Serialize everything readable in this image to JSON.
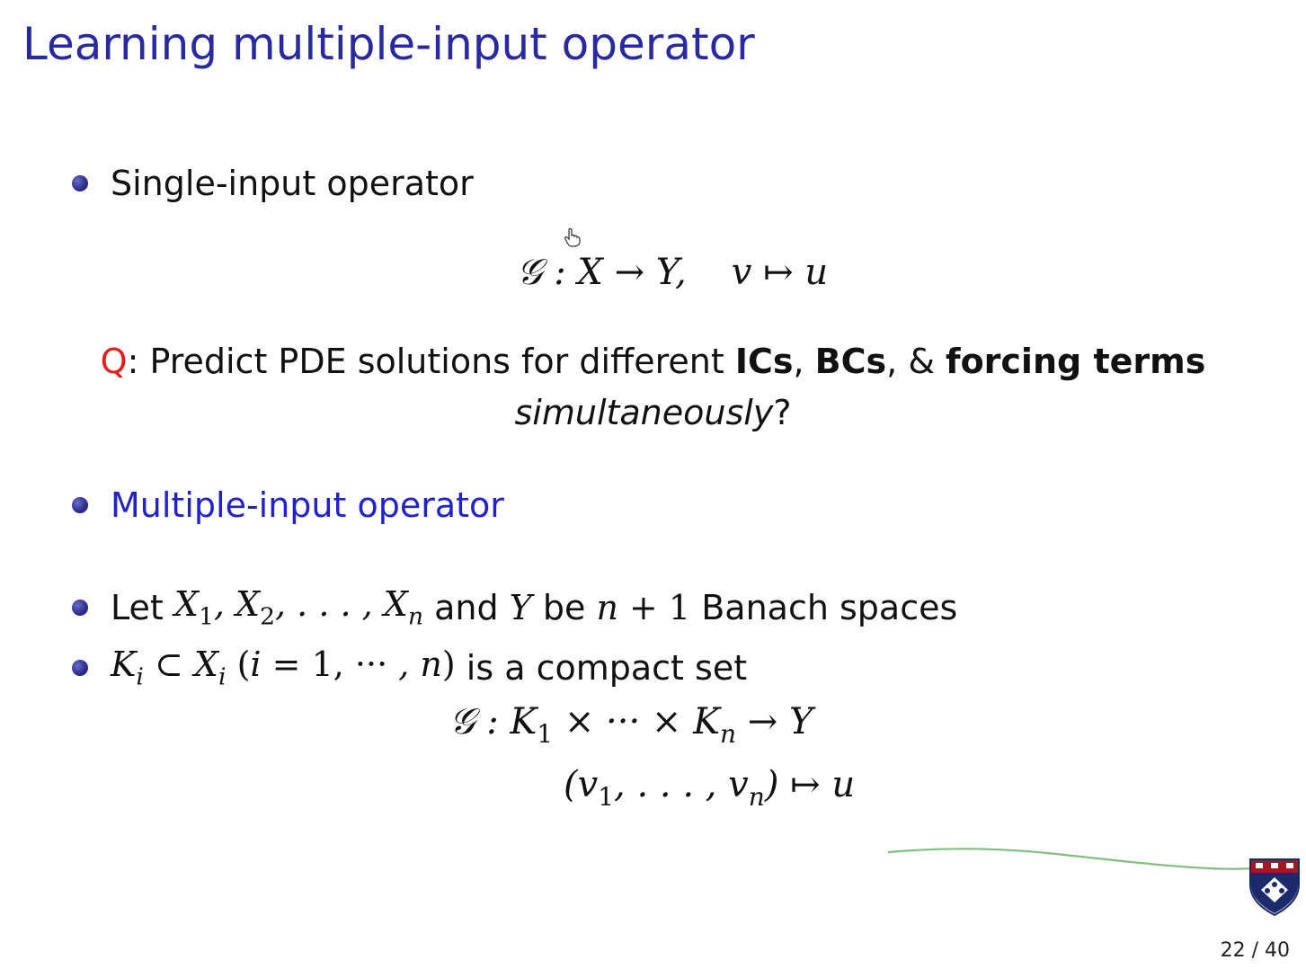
{
  "slide": {
    "title": "Learning multiple-input operator",
    "page_number": "22 / 40"
  },
  "bullets": {
    "single": "Single-input operator",
    "multiple": "Multiple-input operator",
    "let_prefix": "Let",
    "let_and": "and",
    "let_be": "be",
    "let_suffix": "Banach spaces",
    "compact_suffix": "is a compact set"
  },
  "question": {
    "label": "Q",
    "text_start": ": Predict PDE solutions for different ",
    "ics": "ICs",
    "comma1": ", ",
    "bcs": "BCs",
    "amp": ", & ",
    "forcing": "forcing terms",
    "line2_italic": "simultaneously",
    "line2_end": "?"
  },
  "equations": {
    "single_map": "𝒢 : X → Y,",
    "single_assign": "v ↦ u",
    "multi_map_G": "𝒢 : K",
    "multi_map_mid": " × ··· × K",
    "multi_map_end": " → Y",
    "multi_assign_start": "(v",
    "multi_assign_mid": ", . . . , v",
    "multi_assign_end": ") ↦ u"
  },
  "colors": {
    "title": "#2a2aa0",
    "question_label": "#e0201c",
    "highlight": "#2222cc",
    "ink_stroke": "#7fbf7f"
  },
  "icons": {
    "cursor": "hand-cursor-icon",
    "logo": "university-shield-logo"
  }
}
